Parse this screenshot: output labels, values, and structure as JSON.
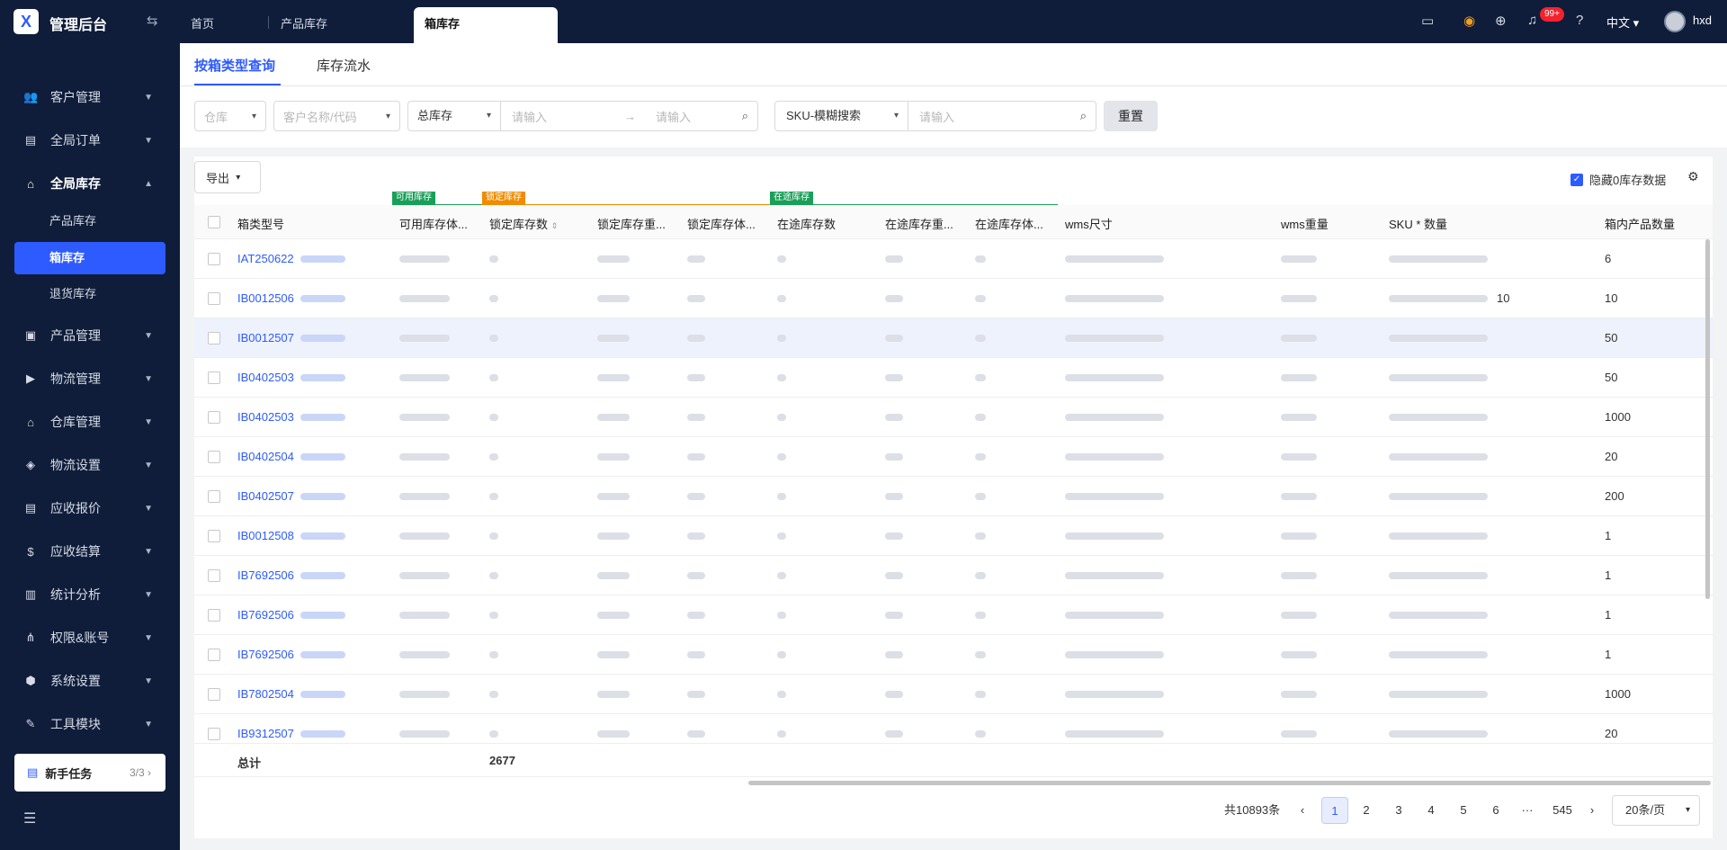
{
  "app": {
    "title": "管理后台",
    "logo": "X"
  },
  "top_tabs": [
    {
      "label": "首页"
    },
    {
      "label": "产品库存"
    },
    {
      "label": "箱库存"
    }
  ],
  "header": {
    "notification_count": "99+",
    "language": "中文",
    "user": "hxd"
  },
  "sidebar": {
    "items": [
      {
        "label": "客户管理",
        "icon": "users-icon"
      },
      {
        "label": "全局订单",
        "icon": "clipboard-icon"
      },
      {
        "label": "全局库存",
        "icon": "warehouse-icon"
      },
      {
        "label": "产品管理",
        "icon": "briefcase-icon"
      },
      {
        "label": "物流管理",
        "icon": "truck-icon"
      },
      {
        "label": "仓库管理",
        "icon": "house-icon"
      },
      {
        "label": "物流设置",
        "icon": "box-icon"
      },
      {
        "label": "应收报价",
        "icon": "document-icon"
      },
      {
        "label": "应收结算",
        "icon": "dollar-icon"
      },
      {
        "label": "统计分析",
        "icon": "chart-icon"
      },
      {
        "label": "权限&账号",
        "icon": "sitemap-icon"
      },
      {
        "label": "系统设置",
        "icon": "gear-icon"
      },
      {
        "label": "工具模块",
        "icon": "wrench-icon"
      }
    ],
    "sub_items": [
      {
        "label": "产品库存"
      },
      {
        "label": "箱库存"
      },
      {
        "label": "退货库存"
      }
    ],
    "newbie": {
      "label": "新手任务",
      "count": "3/3"
    }
  },
  "subtabs": [
    {
      "label": "按箱类型查询"
    },
    {
      "label": "库存流水"
    }
  ],
  "filters": {
    "warehouse_placeholder": "仓库",
    "customer_placeholder": "客户名称/代码",
    "stock_type": "总库存",
    "range_from_placeholder": "请输入",
    "range_to_placeholder": "请输入",
    "sku_mode": "SKU-模糊搜索",
    "sku_placeholder": "请输入",
    "reset_label": "重置"
  },
  "toolbar": {
    "export_label": "导出",
    "hide_zero_label": "隐藏0库存数据"
  },
  "column_groups": [
    {
      "label": "可用库存",
      "color": "#18a058"
    },
    {
      "label": "锁定库存",
      "color": "#f08c00"
    },
    {
      "label": "在途库存",
      "color": "#18a058"
    }
  ],
  "columns": [
    "箱类型号",
    "可用库存体...",
    "锁定库存数",
    "锁定库存重...",
    "锁定库存体...",
    "在途库存数",
    "在途库存重...",
    "在途库存体...",
    "wms尺寸",
    "wms重量",
    "SKU * 数量",
    "箱内产品数量"
  ],
  "rows": [
    {
      "code": "IAT250622",
      "sku_qty": "",
      "box_qty": "6"
    },
    {
      "code": "IB0012506",
      "sku_qty": "10",
      "box_qty": "10"
    },
    {
      "code": "IB0012507",
      "sku_qty": "",
      "box_qty": "50"
    },
    {
      "code": "IB0402503",
      "sku_qty": "",
      "box_qty": "50"
    },
    {
      "code": "IB0402503",
      "sku_qty": "",
      "box_qty": "1000"
    },
    {
      "code": "IB0402504",
      "sku_qty": "",
      "box_qty": "20"
    },
    {
      "code": "IB0402507",
      "sku_qty": "",
      "box_qty": "200"
    },
    {
      "code": "IB0012508",
      "sku_qty": "",
      "box_qty": "1"
    },
    {
      "code": "IB7692506",
      "sku_qty": "",
      "box_qty": "1"
    },
    {
      "code": "IB7692506",
      "sku_qty": "",
      "box_qty": "1"
    },
    {
      "code": "IB7692506",
      "sku_qty": "",
      "box_qty": "1"
    },
    {
      "code": "IB7802504",
      "sku_qty": "",
      "box_qty": "1000"
    },
    {
      "code": "IB9312507",
      "sku_qty": "",
      "box_qty": "20"
    }
  ],
  "totals": {
    "label": "总计",
    "locked_count": "2677"
  },
  "pagination": {
    "total_text": "共10893条",
    "pages": [
      "1",
      "2",
      "3",
      "4",
      "5",
      "6"
    ],
    "ellipsis": "···",
    "last_page": "545",
    "page_size": "20条/页"
  }
}
